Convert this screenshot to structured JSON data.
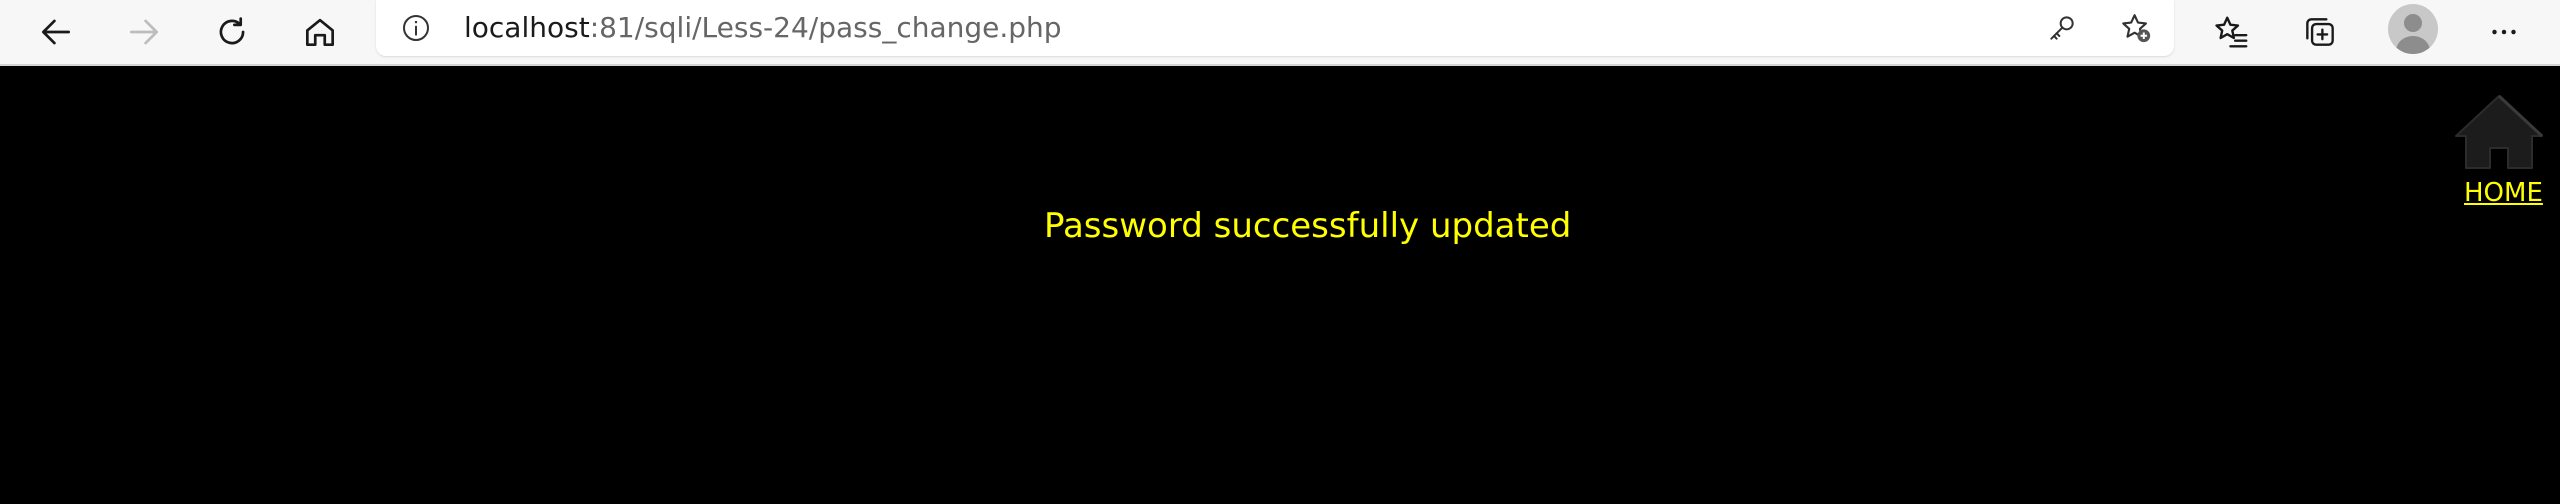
{
  "browser": {
    "address": {
      "host": "localhost",
      "path": ":81/sqli/Less-24/pass_change.php"
    },
    "icons": {
      "back": "back-arrow-icon",
      "forward": "forward-arrow-icon",
      "reload": "reload-icon",
      "home": "home-icon",
      "site_info": "info-icon",
      "password_key": "key-icon",
      "add_favorite": "star-add-icon",
      "favorites": "favorites-icon",
      "collections": "collections-icon",
      "profile": "profile-avatar-icon",
      "menu": "more-icon"
    }
  },
  "page": {
    "message": "Password successfully updated",
    "home_link_label": "HOME",
    "colors": {
      "background": "#000000",
      "text": "#ffff00"
    }
  }
}
